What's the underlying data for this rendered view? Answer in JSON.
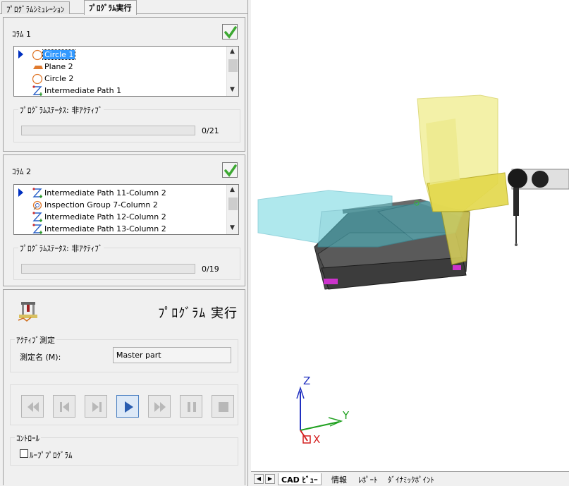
{
  "tabs": [
    {
      "label": "ﾌﾟﾛｸﾞﾗﾑｼﾐｭﾚｰｼｮﾝ",
      "selected": false
    },
    {
      "label": "ﾌﾟﾛｸﾞﾗﾑ実行",
      "selected": true
    }
  ],
  "column1": {
    "title": "ｺﾗﾑ 1",
    "items": [
      {
        "label": "Circle 1",
        "icon": "circle-icon",
        "selected": true
      },
      {
        "label": "Plane 2",
        "icon": "plane-icon"
      },
      {
        "label": "Circle 2",
        "icon": "circle-icon"
      },
      {
        "label": "Intermediate Path 1",
        "icon": "path-icon"
      }
    ],
    "status_label": "ﾌﾟﾛｸﾞﾗﾑｽﾃｰﾀｽ: 非ｱｸﾃｨﾌﾞ",
    "progress_text": "0/21",
    "progress": 0
  },
  "column2": {
    "title": "ｺﾗﾑ 2",
    "items": [
      {
        "label": "Intermediate Path 11-Column 2",
        "icon": "path-icon",
        "selected": false
      },
      {
        "label": "Inspection Group 7-Column 2",
        "icon": "inspection-group-icon"
      },
      {
        "label": "Intermediate Path 12-Column 2",
        "icon": "path-icon"
      },
      {
        "label": "Intermediate Path 13-Column 2",
        "icon": "path-icon"
      }
    ],
    "status_label": "ﾌﾟﾛｸﾞﾗﾑｽﾃｰﾀｽ: 非ｱｸﾃｨﾌﾞ",
    "progress_text": "0/19",
    "progress": 0
  },
  "run": {
    "title": "ﾌﾟﾛｸﾞﾗﾑ 実行",
    "active_measure_title": "ｱｸﾃｨﾌﾞ測定",
    "measure_name_label": "測定名 (M):",
    "measure_name_value": "Master part",
    "controls": [
      "rewind-button",
      "step-back-button",
      "step-forward-button",
      "play-button",
      "fast-forward-button",
      "pause-button",
      "stop-button"
    ],
    "control_title": "ｺﾝﾄﾛｰﾙ",
    "loop_label": "ﾙｰﾌﾟﾌﾟﾛｸﾞﾗﾑ",
    "loop_checked": false
  },
  "view": {
    "axes": {
      "x": "X",
      "y": "Y",
      "z": "Z"
    },
    "bottom_tabs": [
      {
        "label": "CAD ﾋﾞｭｰ",
        "selected": true
      },
      {
        "label": "情報",
        "selected": false
      },
      {
        "label": "ﾚﾎﾟｰﾄ",
        "selected": false
      },
      {
        "label": "ﾀﾞｲﾅﾐｯｸﾎﾟｲﾝﾄ",
        "selected": false
      }
    ]
  },
  "colors": {
    "check_green": "#3da832",
    "selection_blue": "#3399ff",
    "pointer_blue": "#0030c0",
    "axis_z": "#2030c0",
    "axis_y": "#1fa01f",
    "axis_x": "#d42020"
  }
}
